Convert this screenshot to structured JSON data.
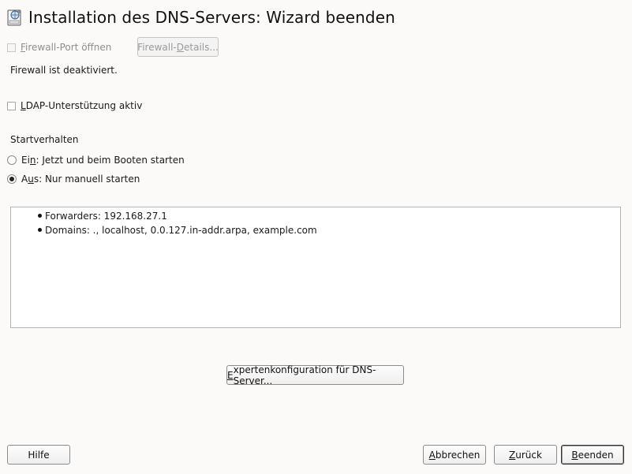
{
  "window": {
    "title": "Installation des DNS-Servers: Wizard beenden",
    "icon": "dns-server-icon"
  },
  "firewall": {
    "open_port": {
      "mnemonic": "F",
      "rest": "irewall-Port öffnen",
      "checked": false,
      "enabled": false
    },
    "details_button": {
      "before": "Firewall-",
      "mnemonic": "D",
      "rest": "etails...",
      "enabled": false
    },
    "status_text": "Firewall ist deaktiviert."
  },
  "ldap": {
    "mnemonic": "L",
    "rest": "DAP-Unterstützung aktiv",
    "checked": false
  },
  "startup": {
    "heading": "Startverhalten",
    "option_on": {
      "before": "Ei",
      "mnemonic": "n",
      "rest": ": Jetzt und beim Booten starten",
      "checked": false
    },
    "option_off": {
      "before": "A",
      "mnemonic": "u",
      "rest": "s: Nur manuell starten",
      "checked": true
    }
  },
  "summary": {
    "items": [
      "Forwarders: 192.168.27.1",
      "Domains: ., localhost, 0.0.127.in-addr.arpa, example.com"
    ]
  },
  "expert_button": {
    "mnemonic": "E",
    "rest": "xpertenkonfiguration für DNS-Server..."
  },
  "footer": {
    "help": "Hilfe",
    "cancel": {
      "mnemonic": "A",
      "rest": "bbrechen"
    },
    "back": {
      "mnemonic": "Z",
      "rest": "urück"
    },
    "finish": {
      "mnemonic": "B",
      "rest": "eenden"
    }
  }
}
